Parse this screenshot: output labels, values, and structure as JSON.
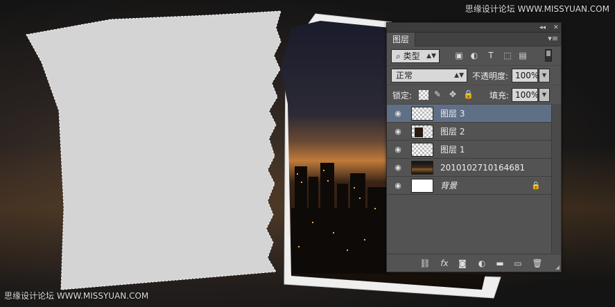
{
  "watermark": {
    "top": "思缘设计论坛 WWW.MISSYUAN.COM",
    "bottom": "思缘设计论坛 WWW.MISSYUAN.COM"
  },
  "panel": {
    "tab_label": "图层",
    "collapse_glyph": "◂◂",
    "close_glyph": "✕",
    "menu_glyph": "▾≡",
    "filter": {
      "search_glyph": "⌕",
      "kind_label": "类型",
      "icons": [
        "image-filter-icon",
        "adjustment-filter-icon",
        "type-filter-icon",
        "shape-filter-icon",
        "smart-object-filter-icon"
      ]
    },
    "blend": {
      "mode": "正常",
      "opacity_label": "不透明度:",
      "opacity_value": "100%"
    },
    "lock": {
      "label": "锁定:",
      "fill_label": "填充:",
      "fill_value": "100%"
    },
    "layers": [
      {
        "name": "图层 3",
        "selected": true,
        "thumb": "checker"
      },
      {
        "name": "图层 2",
        "selected": false,
        "thumb": "checker-photo"
      },
      {
        "name": "图层 1",
        "selected": false,
        "thumb": "checker"
      },
      {
        "name": "2010102710164681",
        "selected": false,
        "thumb": "photo"
      },
      {
        "name": "背景",
        "selected": false,
        "thumb": "white",
        "locked": true
      }
    ],
    "bottom_icons": [
      "link-layers-icon",
      "fx-icon",
      "add-mask-icon",
      "adjustment-layer-icon",
      "new-group-icon",
      "new-layer-icon",
      "delete-layer-icon"
    ],
    "fx_label": "fx"
  },
  "colors": {
    "selected_row": "#5f7086",
    "panel_bg": "#535353",
    "paper": "#d4d4d4"
  }
}
